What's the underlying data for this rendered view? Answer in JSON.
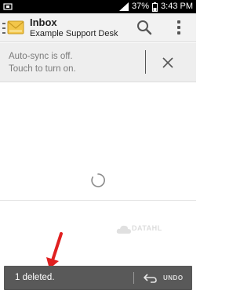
{
  "status_bar": {
    "battery": "37%",
    "time": "3:43 PM"
  },
  "action_bar": {
    "title": "Inbox",
    "subtitle": "Example Support Desk"
  },
  "sync_banner": {
    "line1": "Auto-sync is off.",
    "line2": "Touch to turn on."
  },
  "watermark": {
    "text": "DATAHL"
  },
  "snackbar": {
    "message": "1 deleted.",
    "undo_label": "UNDO"
  },
  "colors": {
    "accent_red": "#e02020",
    "snackbar_bg": "#595959"
  }
}
